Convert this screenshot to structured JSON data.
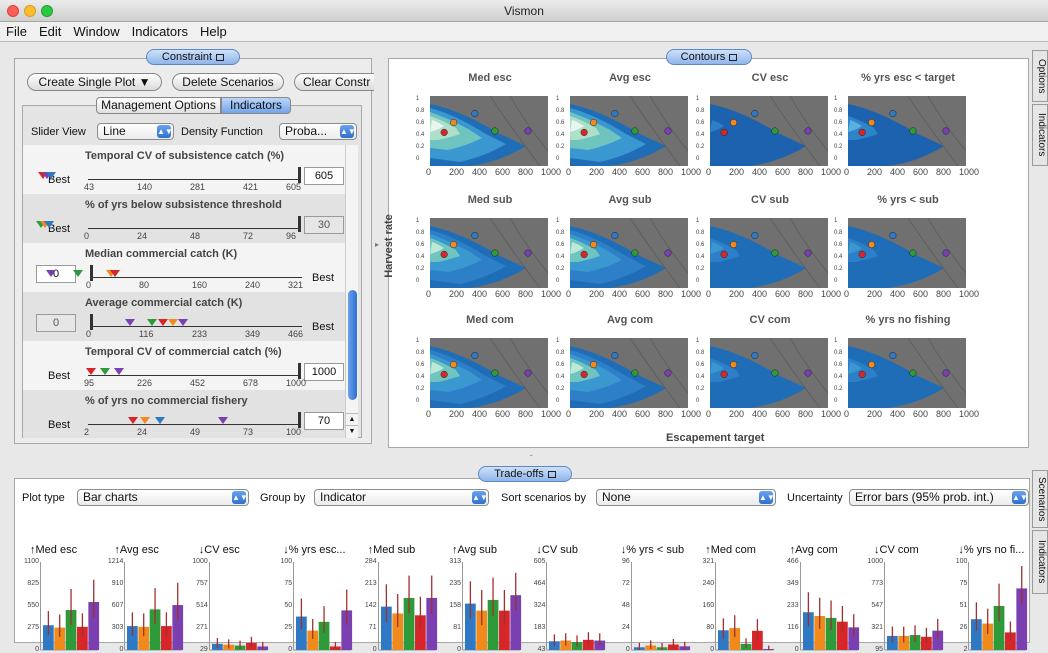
{
  "window": {
    "title": "Vismon"
  },
  "menu": [
    "File",
    "Edit",
    "Window",
    "Indicators",
    "Help"
  ],
  "constraint_panel": {
    "tab_label": "Constraint",
    "buttons": {
      "create_plot": "Create Single Plot ▼",
      "delete": "Delete Scenarios",
      "clear": "Clear Constr"
    },
    "subtabs": [
      "Management Options",
      "Indicators"
    ],
    "slider_view_label": "Slider View",
    "slider_view_value": "Line",
    "density_label": "Density Function",
    "density_value": "Proba..."
  },
  "indicators": [
    {
      "title": "Temporal CV of subsistence catch (%)",
      "ticks": [
        "43",
        "140",
        "281",
        "421",
        "605"
      ],
      "best": "Best",
      "best_side": "left",
      "value": "605",
      "disabled": false
    },
    {
      "title": "% of yrs below subsistence threshold",
      "ticks": [
        "0",
        "24",
        "48",
        "72",
        "96"
      ],
      "best": "Best",
      "best_side": "left",
      "value": "30",
      "disabled": true
    },
    {
      "title": "Median commercial catch (K)",
      "ticks": [
        "0",
        "80",
        "160",
        "240",
        "321"
      ],
      "best": "Best",
      "best_side": "right",
      "value": "0",
      "disabled": false
    },
    {
      "title": "Average commercial catch (K)",
      "ticks": [
        "0",
        "116",
        "233",
        "349",
        "466"
      ],
      "best": "Best",
      "best_side": "right",
      "value": "0",
      "disabled": true
    },
    {
      "title": "Temporal CV of commercial catch (%)",
      "ticks": [
        "95",
        "226",
        "452",
        "678",
        "1000"
      ],
      "best": "Best",
      "best_side": "left",
      "value": "1000",
      "disabled": false
    },
    {
      "title": "% of yrs no commercial fishery",
      "ticks": [
        "2",
        "24",
        "49",
        "73",
        "100"
      ],
      "best": "Best",
      "best_side": "left",
      "value": "70",
      "disabled": false
    }
  ],
  "contours_panel": {
    "tab_label": "Contours",
    "ylabel": "Harvest rate",
    "xlabel": "Escapement target",
    "xticks": [
      "0",
      "200",
      "400",
      "600",
      "800",
      "1000"
    ],
    "yticks": [
      "0",
      "0.2",
      "0.4",
      "0.6",
      "0.8",
      "1"
    ],
    "titles": [
      "Med esc",
      "Avg esc",
      "CV esc",
      "% yrs esc < target",
      "Med sub",
      "Avg sub",
      "CV sub",
      "% yrs < sub",
      "Med com",
      "Avg com",
      "CV com",
      "% yrs no fishing"
    ]
  },
  "tradeoffs_panel": {
    "tab_label": "Trade-offs",
    "plot_type_label": "Plot type",
    "plot_type_value": "Bar charts",
    "group_by_label": "Group by",
    "group_by_value": "Indicator",
    "sort_label": "Sort scenarios by",
    "sort_value": "None",
    "uncertainty_label": "Uncertainty",
    "uncertainty_value": "Error bars (95% prob. int.)"
  },
  "side_tabs": {
    "options": "Options",
    "indicators": "Indicators",
    "scenarios": "Scenarios",
    "indicators2": "Indicators"
  },
  "colors": {
    "blue": "#2f78c4",
    "orange": "#f08a1c",
    "green": "#2f9a3a",
    "red": "#d6262a",
    "purple": "#7a3fb0",
    "accent": "#6b9ce6"
  },
  "chart_data": {
    "type": "bar",
    "series_colors": [
      "#2f78c4",
      "#f08a1c",
      "#2f9a3a",
      "#d6262a",
      "#7a3fb0"
    ],
    "charts": [
      {
        "title": "↑Med esc",
        "ymax": 1100,
        "yticks": [
          "1100",
          "825",
          "550",
          "275",
          "0"
        ],
        "values": [
          310,
          280,
          500,
          290,
          600
        ]
      },
      {
        "title": "↑Avg esc",
        "ymax": 1214,
        "yticks": [
          "1214",
          "910",
          "607",
          "303",
          "0"
        ],
        "values": [
          330,
          320,
          560,
          330,
          620
        ]
      },
      {
        "title": "↓CV esc",
        "ymax": 1000,
        "yticks": [
          "1000",
          "757",
          "514",
          "271",
          "29"
        ],
        "values": [
          70,
          60,
          50,
          80,
          40
        ]
      },
      {
        "title": "↓% yrs esc...",
        "ymax": 100,
        "yticks": [
          "100",
          "75",
          "50",
          "25",
          "0"
        ],
        "values": [
          38,
          22,
          32,
          4,
          45
        ]
      },
      {
        "title": "↑Med sub",
        "ymax": 284,
        "yticks": [
          "284",
          "213",
          "142",
          "71",
          "0"
        ],
        "values": [
          140,
          118,
          168,
          112,
          168
        ]
      },
      {
        "title": "↑Avg sub",
        "ymax": 313,
        "yticks": [
          "313",
          "235",
          "158",
          "81",
          "0"
        ],
        "values": [
          165,
          140,
          178,
          140,
          195
        ]
      },
      {
        "title": "↓CV sub",
        "ymax": 605,
        "yticks": [
          "605",
          "464",
          "324",
          "183",
          "43"
        ],
        "values": [
          60,
          65,
          55,
          70,
          65
        ]
      },
      {
        "title": "↓% yrs < sub",
        "ymax": 96,
        "yticks": [
          "96",
          "72",
          "48",
          "24",
          "0"
        ],
        "values": [
          3,
          5,
          3,
          6,
          4
        ]
      },
      {
        "title": "↑Med com",
        "ymax": 321,
        "yticks": [
          "321",
          "240",
          "160",
          "80",
          "0"
        ],
        "values": [
          72,
          80,
          22,
          70,
          0
        ]
      },
      {
        "title": "↑Avg com",
        "ymax": 466,
        "yticks": [
          "466",
          "349",
          "233",
          "116",
          "0"
        ],
        "values": [
          200,
          180,
          170,
          150,
          120
        ]
      },
      {
        "title": "↓CV com",
        "ymax": 1000,
        "yticks": [
          "1000",
          "773",
          "547",
          "321",
          "95"
        ],
        "values": [
          160,
          160,
          170,
          150,
          220
        ]
      },
      {
        "title": "↓% yrs no fi...",
        "ymax": 100,
        "yticks": [
          "100",
          "75",
          "51",
          "26",
          "2"
        ],
        "values": [
          35,
          30,
          50,
          20,
          70
        ]
      }
    ]
  }
}
